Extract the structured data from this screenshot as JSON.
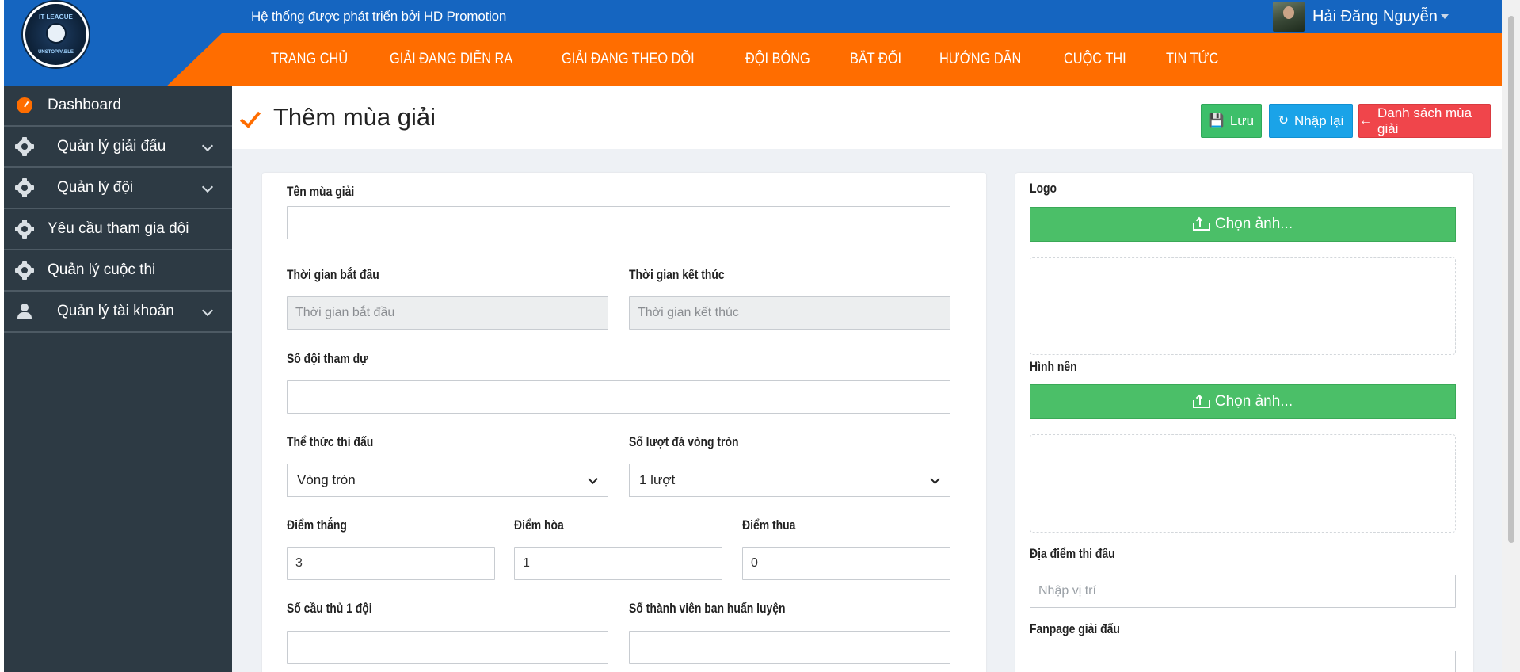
{
  "header": {
    "tagline": "Hệ thống được phát triển bởi HD Promotion",
    "user_name": "Hải Đăng Nguyễn",
    "logo_top": "IT LEAGUE",
    "logo_bottom": "UNSTOPPABLE"
  },
  "nav": {
    "items": [
      "TRANG CHỦ",
      "GIẢI ĐANG DIỄN RA",
      "GIẢI ĐANG THEO DÕI",
      "ĐỘI BÓNG",
      "BẮT ĐỐI",
      "HƯỚNG DẪN",
      "CUỘC THI",
      "TIN TỨC"
    ]
  },
  "sidebar": {
    "items": [
      {
        "label": "Dashboard",
        "icon": "dashboard-icon"
      },
      {
        "label": "Quản lý giải đấu",
        "icon": "gear-icon"
      },
      {
        "label": "Quản lý đội",
        "icon": "gear-icon"
      },
      {
        "label": "Yêu cầu tham gia đội",
        "icon": "gear-icon"
      },
      {
        "label": "Quản lý cuộc thi",
        "icon": "gear-icon"
      },
      {
        "label": "Quản lý tài khoản",
        "icon": "user-icon"
      }
    ]
  },
  "page": {
    "title": "Thêm mùa giải",
    "save_label": "Lưu",
    "reset_label": "Nhập lại",
    "list_label": "Danh sách mùa giải"
  },
  "form": {
    "season_name_label": "Tên mùa giải",
    "season_name_value": "",
    "start_label": "Thời gian bắt đầu",
    "start_placeholder": "Thời gian bắt đầu",
    "end_label": "Thời gian kết thúc",
    "end_placeholder": "Thời gian kết thúc",
    "team_count_label": "Số đội tham dự",
    "team_count_value": "",
    "format_label": "Thể thức thi đấu",
    "format_value": "Vòng tròn",
    "rounds_label": "Số lượt đá vòng tròn",
    "rounds_value": "1 lượt",
    "win_label": "Điểm thắng",
    "win_value": "3",
    "draw_label": "Điểm hòa",
    "draw_value": "1",
    "loss_label": "Điểm thua",
    "loss_value": "0",
    "players_label": "Số cầu thủ 1 đội",
    "players_value": "",
    "coaches_label": "Số thành viên ban huấn luyện",
    "coaches_value": ""
  },
  "media": {
    "logo_label": "Logo",
    "logo_button": "Chọn ảnh...",
    "background_label": "Hình nền",
    "background_button": "Chọn ảnh...",
    "location_label": "Địa điểm thi đấu",
    "location_placeholder": "Nhập vị trí",
    "fanpage_label": "Fanpage giải đấu"
  },
  "colors": {
    "header_blue": "#1565c0",
    "nav_orange": "#ff6d00",
    "sidebar": "#2d3a44",
    "save_green": "#3dbf6a",
    "reset_blue": "#1aa3e8",
    "list_red": "#f0454b"
  }
}
